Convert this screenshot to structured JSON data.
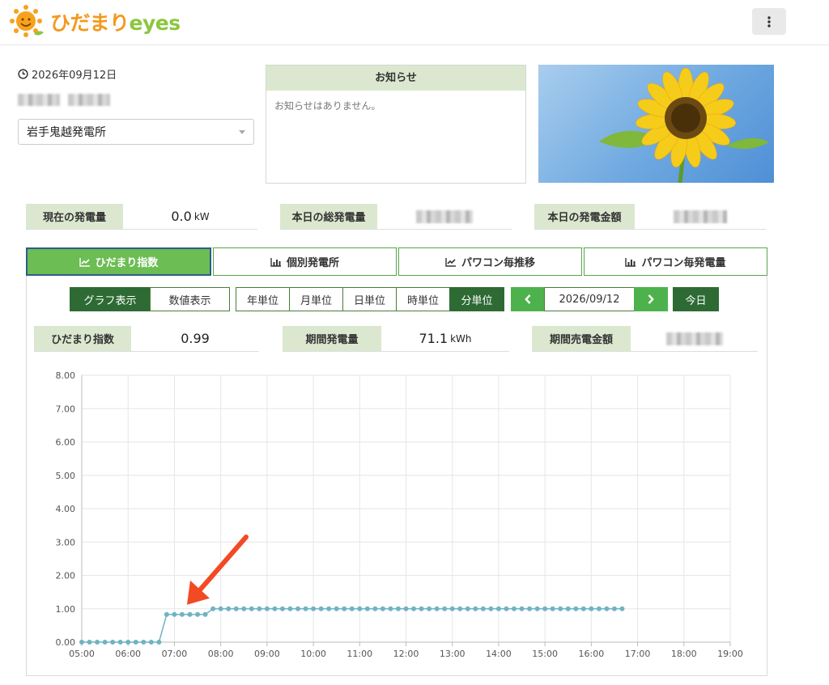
{
  "header": {
    "logo_jp": "ひだまり",
    "logo_en": "eyes",
    "menu_icon": "kebab-menu-icon"
  },
  "info": {
    "date": "2026年09月12日",
    "site_selected": "岩手鬼越発電所"
  },
  "notice": {
    "title": "お知らせ",
    "body": "お知らせはありません。"
  },
  "summary": {
    "current_label": "現在の発電量",
    "current_value": "0.0",
    "current_unit": "kW",
    "total_label": "本日の総発電量",
    "amount_label": "本日の発電金額"
  },
  "tabs": [
    {
      "label": "ひだまり指数",
      "icon": "line-chart-icon",
      "active": true
    },
    {
      "label": "個別発電所",
      "icon": "bar-chart-icon",
      "active": false
    },
    {
      "label": "パワコン毎推移",
      "icon": "line-chart-icon",
      "active": false
    },
    {
      "label": "パワコン毎発電量",
      "icon": "bar-chart-icon",
      "active": false
    }
  ],
  "view_toggle": {
    "graph": "グラフ表示",
    "numeric": "数値表示"
  },
  "units": {
    "year": "年単位",
    "month": "月単位",
    "day": "日単位",
    "hour": "時単位",
    "minute": "分単位"
  },
  "date_nav": {
    "prev": "‹",
    "date": "2026/09/12",
    "next": "›",
    "today": "今日"
  },
  "period": {
    "index_label": "ひだまり指数",
    "index_value": "0.99",
    "gen_label": "期間発電量",
    "gen_value": "71.1",
    "gen_unit": "kWh",
    "sales_label": "期間売電金額"
  },
  "colors": {
    "accent": "#6cbd53",
    "dark_green": "#2e6b34",
    "label_bg": "#dbe8cf",
    "series": "#6fb3c4",
    "arrow": "#f24a24"
  },
  "chart_data": {
    "type": "line",
    "ylim": [
      0,
      8
    ],
    "y_ticks": [
      "0.00",
      "1.00",
      "2.00",
      "3.00",
      "4.00",
      "5.00",
      "6.00",
      "7.00",
      "8.00"
    ],
    "x_ticks": [
      "05:00",
      "06:00",
      "07:00",
      "08:00",
      "09:00",
      "10:00",
      "11:00",
      "12:00",
      "13:00",
      "14:00",
      "15:00",
      "16:00",
      "17:00",
      "18:00",
      "19:00"
    ],
    "grid": true,
    "series": [
      {
        "points": [
          [
            "05:00",
            0
          ],
          [
            "05:10",
            0
          ],
          [
            "05:20",
            0
          ],
          [
            "05:30",
            0
          ],
          [
            "05:40",
            0
          ],
          [
            "05:50",
            0
          ],
          [
            "06:00",
            0
          ],
          [
            "06:10",
            0
          ],
          [
            "06:20",
            0
          ],
          [
            "06:30",
            0
          ],
          [
            "06:40",
            0
          ],
          [
            "06:50",
            0.83
          ],
          [
            "07:00",
            0.83
          ],
          [
            "07:10",
            0.83
          ],
          [
            "07:20",
            0.83
          ],
          [
            "07:30",
            0.83
          ],
          [
            "07:40",
            0.83
          ],
          [
            "07:50",
            1.0
          ],
          [
            "08:00",
            1.0
          ],
          [
            "08:10",
            1.0
          ],
          [
            "08:20",
            1.0
          ],
          [
            "08:30",
            1.0
          ],
          [
            "08:40",
            1.0
          ],
          [
            "08:50",
            1.0
          ],
          [
            "09:00",
            1.0
          ],
          [
            "09:10",
            1.0
          ],
          [
            "09:20",
            1.0
          ],
          [
            "09:30",
            1.0
          ],
          [
            "09:40",
            1.0
          ],
          [
            "09:50",
            1.0
          ],
          [
            "10:00",
            1.0
          ],
          [
            "10:10",
            1.0
          ],
          [
            "10:20",
            1.0
          ],
          [
            "10:30",
            1.0
          ],
          [
            "10:40",
            1.0
          ],
          [
            "10:50",
            1.0
          ],
          [
            "11:00",
            1.0
          ],
          [
            "11:10",
            1.0
          ],
          [
            "11:20",
            1.0
          ],
          [
            "11:30",
            1.0
          ],
          [
            "11:40",
            1.0
          ],
          [
            "11:50",
            1.0
          ],
          [
            "12:00",
            1.0
          ],
          [
            "12:10",
            1.0
          ],
          [
            "12:20",
            1.0
          ],
          [
            "12:30",
            1.0
          ],
          [
            "12:40",
            1.0
          ],
          [
            "12:50",
            1.0
          ],
          [
            "13:00",
            1.0
          ],
          [
            "13:10",
            1.0
          ],
          [
            "13:20",
            1.0
          ],
          [
            "13:30",
            1.0
          ],
          [
            "13:40",
            1.0
          ],
          [
            "13:50",
            1.0
          ],
          [
            "14:00",
            1.0
          ],
          [
            "14:10",
            1.0
          ],
          [
            "14:20",
            1.0
          ],
          [
            "14:30",
            1.0
          ],
          [
            "14:40",
            1.0
          ],
          [
            "14:50",
            1.0
          ],
          [
            "15:00",
            1.0
          ],
          [
            "15:10",
            1.0
          ],
          [
            "15:20",
            1.0
          ],
          [
            "15:30",
            1.0
          ],
          [
            "15:40",
            1.0
          ],
          [
            "15:50",
            1.0
          ],
          [
            "16:00",
            1.0
          ],
          [
            "16:10",
            1.0
          ],
          [
            "16:20",
            1.0
          ],
          [
            "16:30",
            1.0
          ],
          [
            "16:40",
            1.0
          ]
        ]
      }
    ]
  }
}
